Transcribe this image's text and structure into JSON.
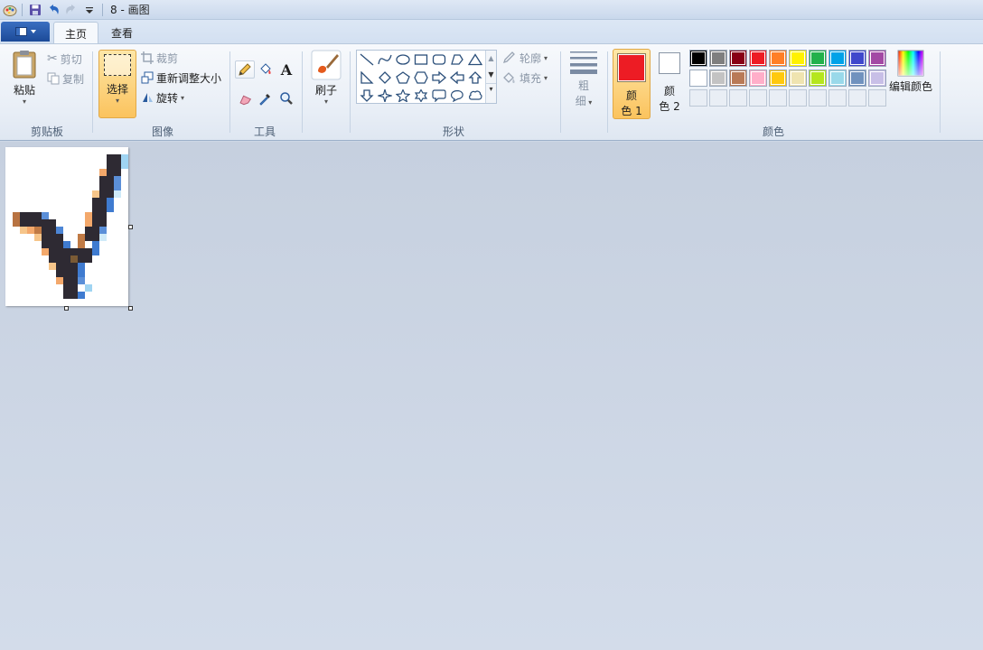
{
  "window": {
    "title": "8 - 画图"
  },
  "tabs": [
    {
      "label": "主页",
      "active": true
    },
    {
      "label": "查看",
      "active": false
    }
  ],
  "clipboard": {
    "paste_label": "粘贴",
    "cut_label": "剪切",
    "copy_label": "复制",
    "group_label": "剪贴板"
  },
  "image": {
    "select_label": "选择",
    "crop_label": "裁剪",
    "resize_label": "重新调整大小",
    "rotate_label": "旋转",
    "group_label": "图像"
  },
  "tools": {
    "group_label": "工具",
    "items": [
      "pencil-icon",
      "fill-icon",
      "text-icon",
      "eraser-icon",
      "color-picker-icon",
      "magnifier-icon"
    ]
  },
  "brushes": {
    "label": "刷子"
  },
  "shapes": {
    "group_label": "形状",
    "outline_label": "轮廓",
    "fill_label": "填充",
    "items": [
      "line",
      "curve",
      "oval",
      "rectangle",
      "rounded-rectangle",
      "polygon",
      "triangle",
      "right-triangle",
      "diamond",
      "pentagon",
      "hexagon",
      "right-arrow",
      "left-arrow",
      "up-arrow",
      "down-arrow",
      "four-point-star",
      "five-point-star",
      "six-point-star",
      "rounded-callout",
      "oval-callout",
      "cloud-callout"
    ]
  },
  "size": {
    "label_line1": "粗",
    "label_line2": "细"
  },
  "colors": {
    "group_label": "颜色",
    "color1_line1": "颜",
    "color1_line2": "色 1",
    "color2_line1": "颜",
    "color2_line2": "色 2",
    "color1_value": "#ed1c24",
    "color2_value": "#ffffff",
    "edit_label": "编辑颜色",
    "palette_row1": [
      "#000000",
      "#7f7f7f",
      "#880015",
      "#ed1c24",
      "#ff7f27",
      "#fff200",
      "#22b14c",
      "#00a2e8",
      "#3f48cc",
      "#a349a4"
    ],
    "palette_row2": [
      "#ffffff",
      "#c3c3c3",
      "#b97a57",
      "#ffaec9",
      "#ffc90e",
      "#efe4b0",
      "#b5e61d",
      "#99d9ea",
      "#7092be",
      "#c8bfe7"
    ],
    "palette_row3_empty_count": 10
  }
}
